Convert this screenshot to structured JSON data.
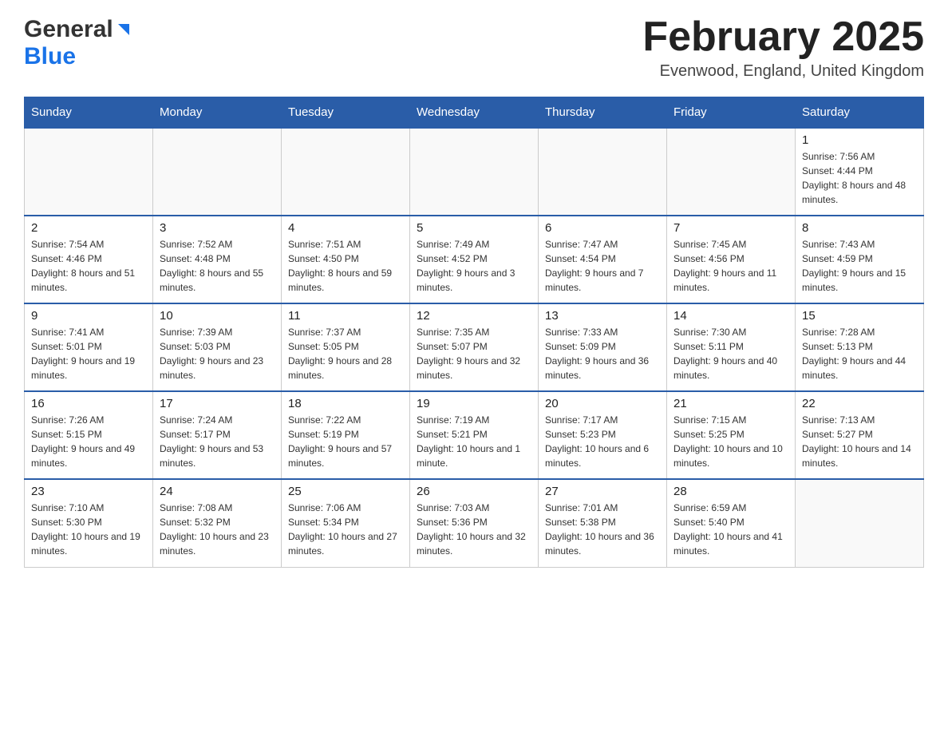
{
  "header": {
    "logo": {
      "general": "General",
      "blue": "Blue"
    },
    "title": "February 2025",
    "location": "Evenwood, England, United Kingdom"
  },
  "weekdays": [
    "Sunday",
    "Monday",
    "Tuesday",
    "Wednesday",
    "Thursday",
    "Friday",
    "Saturday"
  ],
  "weeks": [
    [
      {
        "day": "",
        "info": ""
      },
      {
        "day": "",
        "info": ""
      },
      {
        "day": "",
        "info": ""
      },
      {
        "day": "",
        "info": ""
      },
      {
        "day": "",
        "info": ""
      },
      {
        "day": "",
        "info": ""
      },
      {
        "day": "1",
        "info": "Sunrise: 7:56 AM\nSunset: 4:44 PM\nDaylight: 8 hours and 48 minutes."
      }
    ],
    [
      {
        "day": "2",
        "info": "Sunrise: 7:54 AM\nSunset: 4:46 PM\nDaylight: 8 hours and 51 minutes."
      },
      {
        "day": "3",
        "info": "Sunrise: 7:52 AM\nSunset: 4:48 PM\nDaylight: 8 hours and 55 minutes."
      },
      {
        "day": "4",
        "info": "Sunrise: 7:51 AM\nSunset: 4:50 PM\nDaylight: 8 hours and 59 minutes."
      },
      {
        "day": "5",
        "info": "Sunrise: 7:49 AM\nSunset: 4:52 PM\nDaylight: 9 hours and 3 minutes."
      },
      {
        "day": "6",
        "info": "Sunrise: 7:47 AM\nSunset: 4:54 PM\nDaylight: 9 hours and 7 minutes."
      },
      {
        "day": "7",
        "info": "Sunrise: 7:45 AM\nSunset: 4:56 PM\nDaylight: 9 hours and 11 minutes."
      },
      {
        "day": "8",
        "info": "Sunrise: 7:43 AM\nSunset: 4:59 PM\nDaylight: 9 hours and 15 minutes."
      }
    ],
    [
      {
        "day": "9",
        "info": "Sunrise: 7:41 AM\nSunset: 5:01 PM\nDaylight: 9 hours and 19 minutes."
      },
      {
        "day": "10",
        "info": "Sunrise: 7:39 AM\nSunset: 5:03 PM\nDaylight: 9 hours and 23 minutes."
      },
      {
        "day": "11",
        "info": "Sunrise: 7:37 AM\nSunset: 5:05 PM\nDaylight: 9 hours and 28 minutes."
      },
      {
        "day": "12",
        "info": "Sunrise: 7:35 AM\nSunset: 5:07 PM\nDaylight: 9 hours and 32 minutes."
      },
      {
        "day": "13",
        "info": "Sunrise: 7:33 AM\nSunset: 5:09 PM\nDaylight: 9 hours and 36 minutes."
      },
      {
        "day": "14",
        "info": "Sunrise: 7:30 AM\nSunset: 5:11 PM\nDaylight: 9 hours and 40 minutes."
      },
      {
        "day": "15",
        "info": "Sunrise: 7:28 AM\nSunset: 5:13 PM\nDaylight: 9 hours and 44 minutes."
      }
    ],
    [
      {
        "day": "16",
        "info": "Sunrise: 7:26 AM\nSunset: 5:15 PM\nDaylight: 9 hours and 49 minutes."
      },
      {
        "day": "17",
        "info": "Sunrise: 7:24 AM\nSunset: 5:17 PM\nDaylight: 9 hours and 53 minutes."
      },
      {
        "day": "18",
        "info": "Sunrise: 7:22 AM\nSunset: 5:19 PM\nDaylight: 9 hours and 57 minutes."
      },
      {
        "day": "19",
        "info": "Sunrise: 7:19 AM\nSunset: 5:21 PM\nDaylight: 10 hours and 1 minute."
      },
      {
        "day": "20",
        "info": "Sunrise: 7:17 AM\nSunset: 5:23 PM\nDaylight: 10 hours and 6 minutes."
      },
      {
        "day": "21",
        "info": "Sunrise: 7:15 AM\nSunset: 5:25 PM\nDaylight: 10 hours and 10 minutes."
      },
      {
        "day": "22",
        "info": "Sunrise: 7:13 AM\nSunset: 5:27 PM\nDaylight: 10 hours and 14 minutes."
      }
    ],
    [
      {
        "day": "23",
        "info": "Sunrise: 7:10 AM\nSunset: 5:30 PM\nDaylight: 10 hours and 19 minutes."
      },
      {
        "day": "24",
        "info": "Sunrise: 7:08 AM\nSunset: 5:32 PM\nDaylight: 10 hours and 23 minutes."
      },
      {
        "day": "25",
        "info": "Sunrise: 7:06 AM\nSunset: 5:34 PM\nDaylight: 10 hours and 27 minutes."
      },
      {
        "day": "26",
        "info": "Sunrise: 7:03 AM\nSunset: 5:36 PM\nDaylight: 10 hours and 32 minutes."
      },
      {
        "day": "27",
        "info": "Sunrise: 7:01 AM\nSunset: 5:38 PM\nDaylight: 10 hours and 36 minutes."
      },
      {
        "day": "28",
        "info": "Sunrise: 6:59 AM\nSunset: 5:40 PM\nDaylight: 10 hours and 41 minutes."
      },
      {
        "day": "",
        "info": ""
      }
    ]
  ],
  "colors": {
    "header_bg": "#2a5da8",
    "header_text": "#ffffff",
    "border": "#2a5da8",
    "empty_bg": "#f9f9f9"
  }
}
